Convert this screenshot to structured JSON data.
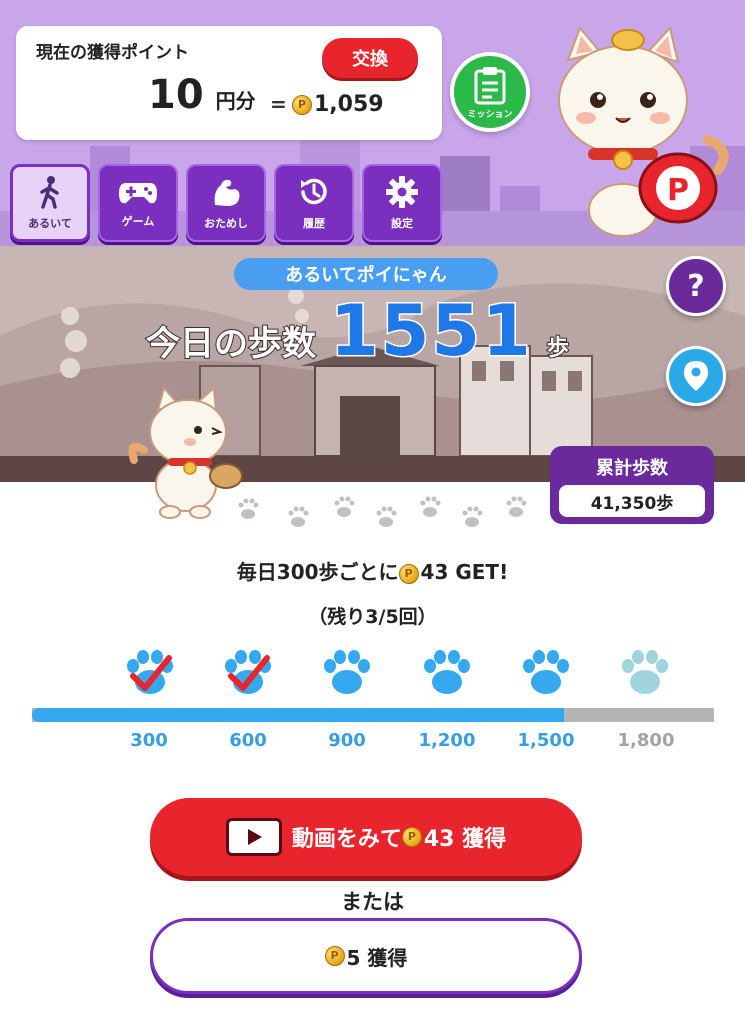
{
  "header": {
    "points_title": "現在の獲得ポイント",
    "exchange_label": "交換",
    "yen_value": "10",
    "yen_unit": "円分",
    "equals": "=",
    "coin_value": "1,059",
    "mission_label": "ミッション",
    "mascot_badge": "P"
  },
  "nav": [
    {
      "label": "あるいて",
      "active": true
    },
    {
      "label": "ゲーム",
      "active": false
    },
    {
      "label": "おためし",
      "active": false
    },
    {
      "label": "履歴",
      "active": false
    },
    {
      "label": "設定",
      "active": false
    }
  ],
  "scene": {
    "title": "あるいてポイにゃん",
    "steps_label": "今日の歩数",
    "steps_value": "1551",
    "steps_unit": "歩",
    "help_label": "?",
    "total_label": "累計歩数",
    "total_value": "41,350歩"
  },
  "reward": {
    "line_prefix": "毎日300歩ごとに",
    "line_amount": "43 GET!",
    "remaining": "（残り3/5回）"
  },
  "milestones": {
    "labels": [
      "300",
      "600",
      "900",
      "1,200",
      "1,500",
      "1,800"
    ],
    "checked": [
      true,
      true,
      false,
      false,
      false,
      false
    ],
    "progress_fraction": 0.78
  },
  "actions": {
    "watch_prefix": "動画をみて",
    "watch_suffix": "43 獲得",
    "or_label": "または",
    "get5_label": "5 獲得"
  },
  "colors": {
    "header_bg": "#c9a6ea",
    "accent_purple": "#7b2fbe",
    "red": "#e8242c",
    "blue": "#35a8f0",
    "green": "#2bb94a"
  }
}
